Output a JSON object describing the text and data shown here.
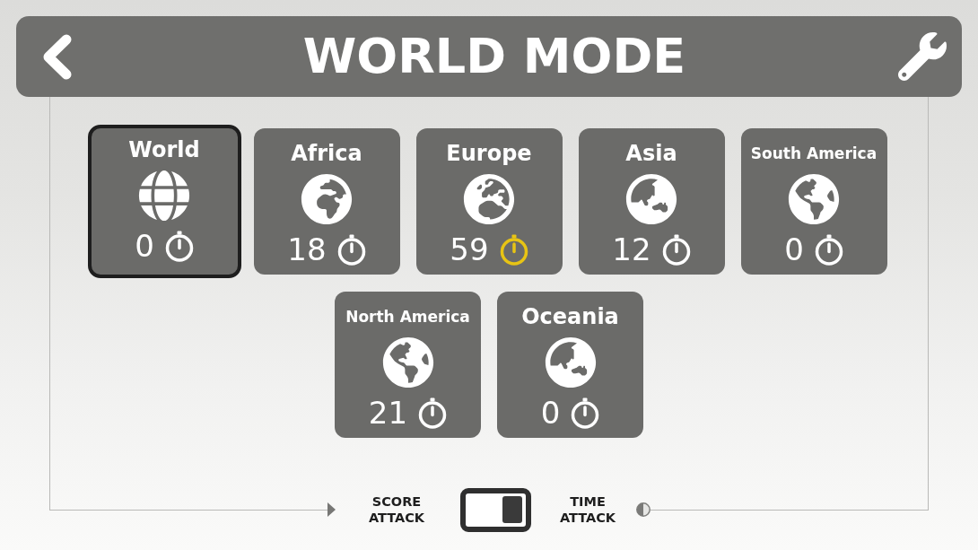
{
  "header": {
    "title": "WORLD MODE"
  },
  "rows": [
    {
      "cards": [
        {
          "kind": "all",
          "name": "World",
          "count": "0",
          "selected": true,
          "timer_highlighted": false
        },
        {
          "kind": "region",
          "name": "Africa",
          "count": "18",
          "selected": false,
          "timer_highlighted": false
        },
        {
          "kind": "region",
          "name": "Europe",
          "count": "59",
          "selected": false,
          "timer_highlighted": true
        },
        {
          "kind": "region",
          "name": "Asia",
          "count": "12",
          "selected": false,
          "timer_highlighted": false
        },
        {
          "kind": "region",
          "name": "South America",
          "count": "0",
          "selected": false,
          "timer_highlighted": false
        }
      ]
    },
    {
      "cards": [
        {
          "kind": "region",
          "name": "North America",
          "count": "21",
          "selected": false,
          "timer_highlighted": false
        },
        {
          "kind": "region",
          "name": "Oceania",
          "count": "0",
          "selected": false,
          "timer_highlighted": false
        }
      ]
    }
  ],
  "mode_switch": {
    "left_label": "SCORE ATTACK",
    "right_label": "TIME ATTACK",
    "on": true
  }
}
